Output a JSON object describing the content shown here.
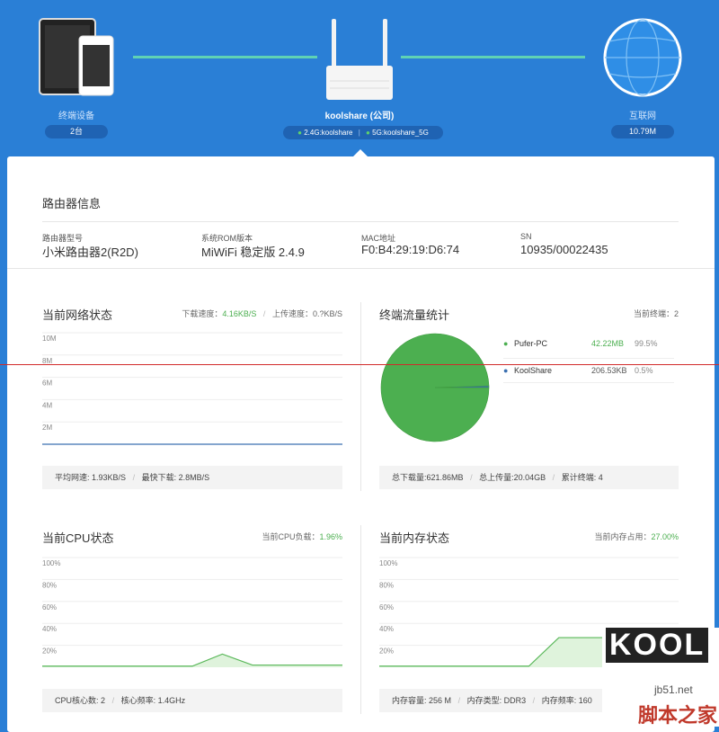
{
  "topology": {
    "terminal": {
      "label": "终端设备",
      "count": "2台"
    },
    "router": {
      "name": "koolshare (公司)",
      "wifi24": "2.4G:koolshare",
      "wifi5": "5G:koolshare_5G"
    },
    "internet": {
      "label": "互联网",
      "speed": "10.79M"
    }
  },
  "router_info": {
    "title": "路由器信息",
    "fields": [
      {
        "label": "路由器型号",
        "value": "小米路由器2(R2D)"
      },
      {
        "label": "系统ROM版本",
        "value": "MiWiFi 稳定版 2.4.9"
      },
      {
        "label": "MAC地址",
        "value": "F0:B4:29:19:D6:74"
      },
      {
        "label": "SN",
        "value": "10935/00022435"
      }
    ]
  },
  "network": {
    "title": "当前网络状态",
    "download_label": "下载速度：",
    "download_value": "4.16KB/S",
    "upload_label": "上传速度：",
    "upload_value": "0.?KB/S",
    "avg_label": "平均网速:",
    "avg_value": "1.93KB/S",
    "max_label": "最快下载:",
    "max_value": "2.8MB/S"
  },
  "traffic": {
    "title": "终端流量统计",
    "current_label": "当前终端：",
    "current_value": "2",
    "total_down_label": "总下载量:",
    "total_down_value": "621.86MB",
    "total_up_label": "总上传量:",
    "total_up_value": "20.04GB",
    "cumulative_label": "累计终端:",
    "cumulative_value": "4",
    "legend": [
      {
        "name": "Pufer-PC",
        "amount": "42.22MB",
        "pct": "99.5%",
        "color": "#4caf50"
      },
      {
        "name": "KoolShare",
        "amount": "206.53KB",
        "pct": "0.5%",
        "color": "#3a6fb0"
      }
    ]
  },
  "cpu": {
    "title": "当前CPU状态",
    "load_label": "当前CPU负载：",
    "load_value": "1.96%",
    "cores_label": "CPU核心数:",
    "cores_value": "2",
    "freq_label": "核心频率:",
    "freq_value": "1.4GHz"
  },
  "memory": {
    "title": "当前内存状态",
    "usage_label": "当前内存占用：",
    "usage_value": "27.00%",
    "capacity_label": "内存容量:",
    "capacity_value": "256 M",
    "type_label": "内存类型:",
    "type_value": "DDR3",
    "freq_label": "内存频率:",
    "freq_value": "160"
  },
  "watermark": {
    "brand": "KOOL",
    "site": "jb51.net",
    "site_cn": "脚本之家"
  },
  "chart_data": [
    {
      "type": "line",
      "title": "当前网络状态",
      "yticks": [
        "10M",
        "8M",
        "6M",
        "4M",
        "2M"
      ],
      "ylim": [
        0,
        10
      ],
      "x": [
        0,
        1,
        2,
        3,
        4,
        5,
        6,
        7,
        8,
        9,
        10
      ],
      "series": [
        {
          "values": [
            0,
            0,
            0,
            0,
            0,
            0,
            0,
            0,
            0,
            0,
            0
          ]
        }
      ]
    },
    {
      "type": "pie",
      "title": "终端流量统计",
      "categories": [
        "Pufer-PC",
        "KoolShare"
      ],
      "values": [
        99.5,
        0.5
      ]
    },
    {
      "type": "area",
      "title": "当前CPU状态",
      "yticks": [
        "100%",
        "80%",
        "60%",
        "40%",
        "20%"
      ],
      "ylim": [
        0,
        100
      ],
      "x": [
        0,
        1,
        2,
        3,
        4,
        5,
        6,
        7,
        8,
        9,
        10
      ],
      "series": [
        {
          "values": [
            1,
            1,
            1,
            1,
            1,
            1,
            12,
            2,
            2,
            2,
            2
          ]
        }
      ]
    },
    {
      "type": "area",
      "title": "当前内存状态",
      "yticks": [
        "100%",
        "80%",
        "60%",
        "40%",
        "20%"
      ],
      "ylim": [
        0,
        100
      ],
      "x": [
        0,
        1,
        2,
        3,
        4,
        5,
        6,
        7,
        8,
        9,
        10
      ],
      "series": [
        {
          "values": [
            1,
            1,
            1,
            1,
            1,
            1,
            27,
            27,
            27,
            27,
            27
          ]
        }
      ]
    }
  ]
}
